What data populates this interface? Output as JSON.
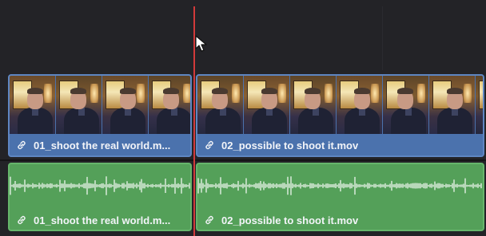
{
  "timeline": {
    "video_track": {
      "clips": [
        {
          "label": "01_shoot the real world.m..."
        },
        {
          "label": "02_possible to shoot it.mov"
        }
      ]
    },
    "audio_track": {
      "clips": [
        {
          "label": "01_shoot the real world.m..."
        },
        {
          "label": "02_possible to shoot it.mov"
        }
      ]
    }
  },
  "icons": {
    "link": "link-icon",
    "cursor": "mouse-pointer-icon"
  },
  "colors": {
    "background": "#232327",
    "video_clip": "#4b72ad",
    "audio_clip": "#54a059",
    "playhead": "#d23a3a",
    "label_text": "#f2f4f8"
  }
}
